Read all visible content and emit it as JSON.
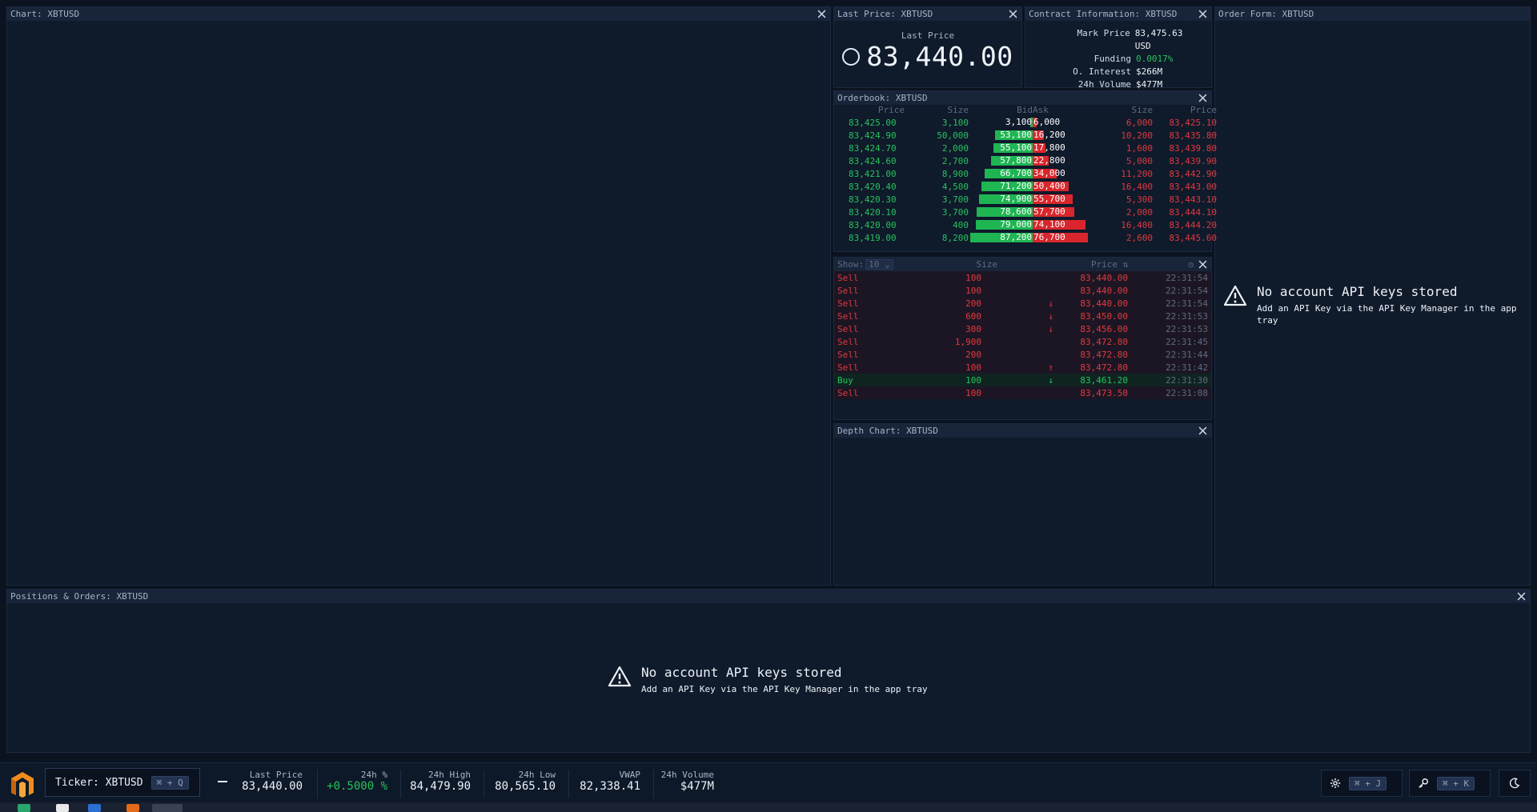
{
  "panels": {
    "chart": {
      "title": "Chart: XBTUSD"
    },
    "last_price": {
      "title": "Last Price: XBTUSD",
      "label": "Last Price",
      "value": "83,440.00"
    },
    "contract_info": {
      "title": "Contract Information: XBTUSD",
      "rows": [
        {
          "key": "Mark Price",
          "value": "83,475.63 USD"
        },
        {
          "key": "Funding",
          "value": "0.0017%"
        },
        {
          "key": "O. Interest",
          "value": "$266M"
        },
        {
          "key": "24h Volume",
          "value": "$477M"
        }
      ]
    },
    "order_form": {
      "title": "Order Form: XBTUSD"
    },
    "orderbook": {
      "title": "Orderbook: XBTUSD",
      "headers": {
        "bid_price": "Price",
        "bid_size": "Size",
        "bid": "Bid",
        "ask": "Ask",
        "ask_size": "Size",
        "ask_price": "Price"
      },
      "rows": [
        {
          "bid_price": "83,425.00",
          "bid_size": "3,100",
          "bid_total": "3,100",
          "ask_total": "6,000",
          "ask_size": "6,000",
          "ask_price": "83,425.10",
          "bid_depth": 3100,
          "ask_depth": 6000
        },
        {
          "bid_price": "83,424.90",
          "bid_size": "50,000",
          "bid_total": "53,100",
          "ask_total": "16,200",
          "ask_size": "10,200",
          "ask_price": "83,435.80",
          "bid_depth": 53100,
          "ask_depth": 16200
        },
        {
          "bid_price": "83,424.70",
          "bid_size": "2,000",
          "bid_total": "55,100",
          "ask_total": "17,800",
          "ask_size": "1,600",
          "ask_price": "83,439.80",
          "bid_depth": 55100,
          "ask_depth": 17800
        },
        {
          "bid_price": "83,424.60",
          "bid_size": "2,700",
          "bid_total": "57,800",
          "ask_total": "22,800",
          "ask_size": "5,000",
          "ask_price": "83,439.90",
          "bid_depth": 57800,
          "ask_depth": 22800
        },
        {
          "bid_price": "83,421.00",
          "bid_size": "8,900",
          "bid_total": "66,700",
          "ask_total": "34,000",
          "ask_size": "11,200",
          "ask_price": "83,442.90",
          "bid_depth": 66700,
          "ask_depth": 34000
        },
        {
          "bid_price": "83,420.40",
          "bid_size": "4,500",
          "bid_total": "71,200",
          "ask_total": "50,400",
          "ask_size": "16,400",
          "ask_price": "83,443.00",
          "bid_depth": 71200,
          "ask_depth": 50400
        },
        {
          "bid_price": "83,420.30",
          "bid_size": "3,700",
          "bid_total": "74,900",
          "ask_total": "55,700",
          "ask_size": "5,300",
          "ask_price": "83,443.10",
          "bid_depth": 74900,
          "ask_depth": 55700
        },
        {
          "bid_price": "83,420.10",
          "bid_size": "3,700",
          "bid_total": "78,600",
          "ask_total": "57,700",
          "ask_size": "2,000",
          "ask_price": "83,444.10",
          "bid_depth": 78600,
          "ask_depth": 57700
        },
        {
          "bid_price": "83,420.00",
          "bid_size": "400",
          "bid_total": "79,000",
          "ask_total": "74,100",
          "ask_size": "16,400",
          "ask_price": "83,444.20",
          "bid_depth": 79000,
          "ask_depth": 74100
        },
        {
          "bid_price": "83,419.00",
          "bid_size": "8,200",
          "bid_total": "87,200",
          "ask_total": "76,700",
          "ask_size": "2,600",
          "ask_price": "83,445.60",
          "bid_depth": 87200,
          "ask_depth": 76700
        }
      ]
    },
    "trades": {
      "show_label": "Show:",
      "show_value": "10",
      "headers": {
        "size": "Size",
        "price": "Price"
      },
      "rows": [
        {
          "side": "Sell",
          "size": "100",
          "arrow": "",
          "price": "83,440.00",
          "time": "22:31:54"
        },
        {
          "side": "Sell",
          "size": "100",
          "arrow": "",
          "price": "83,440.00",
          "time": "22:31:54"
        },
        {
          "side": "Sell",
          "size": "200",
          "arrow": "↓",
          "price": "83,440.00",
          "time": "22:31:54"
        },
        {
          "side": "Sell",
          "size": "600",
          "arrow": "↓",
          "price": "83,450.00",
          "time": "22:31:53"
        },
        {
          "side": "Sell",
          "size": "300",
          "arrow": "↓",
          "price": "83,456.00",
          "time": "22:31:53"
        },
        {
          "side": "Sell",
          "size": "1,900",
          "arrow": "",
          "price": "83,472.80",
          "time": "22:31:45"
        },
        {
          "side": "Sell",
          "size": "200",
          "arrow": "",
          "price": "83,472.80",
          "time": "22:31:44"
        },
        {
          "side": "Sell",
          "size": "100",
          "arrow": "↑",
          "price": "83,472.80",
          "time": "22:31:42"
        },
        {
          "side": "Buy",
          "size": "100",
          "arrow": "↓",
          "price": "83,461.20",
          "time": "22:31:30"
        },
        {
          "side": "Sell",
          "size": "100",
          "arrow": "",
          "price": "83,473.50",
          "time": "22:31:08"
        }
      ]
    },
    "depth_chart": {
      "title": "Depth Chart: XBTUSD"
    },
    "positions": {
      "title": "Positions & Orders: XBTUSD"
    }
  },
  "no_keys": {
    "title": "No account API keys stored",
    "subtitle": "Add an API Key via the API Key Manager in the app tray"
  },
  "bottombar": {
    "ticker_label": "Ticker: XBTUSD",
    "ticker_shortcut": "⌘ + Q",
    "stats": [
      {
        "label": "Last Price",
        "value": "83,440.00"
      },
      {
        "label": "24h %",
        "value": "+0.5000 %"
      },
      {
        "label": "24h High",
        "value": "84,479.90"
      },
      {
        "label": "24h Low",
        "value": "80,565.10"
      },
      {
        "label": "VWAP",
        "value": "82,338.41"
      },
      {
        "label": "24h Volume",
        "value": "$477M"
      }
    ],
    "settings_shortcut": "⌘ + J",
    "keys_shortcut": "⌘ + K"
  },
  "colors": {
    "bid": "#1fb552",
    "ask": "#d8262c",
    "accent": "#27c35b"
  },
  "icons": [
    "close-icon",
    "warning-icon",
    "gear-icon",
    "key-icon",
    "moon-icon",
    "logo-icon",
    "chevron-down-icon",
    "sort-icon",
    "clock-icon"
  ]
}
